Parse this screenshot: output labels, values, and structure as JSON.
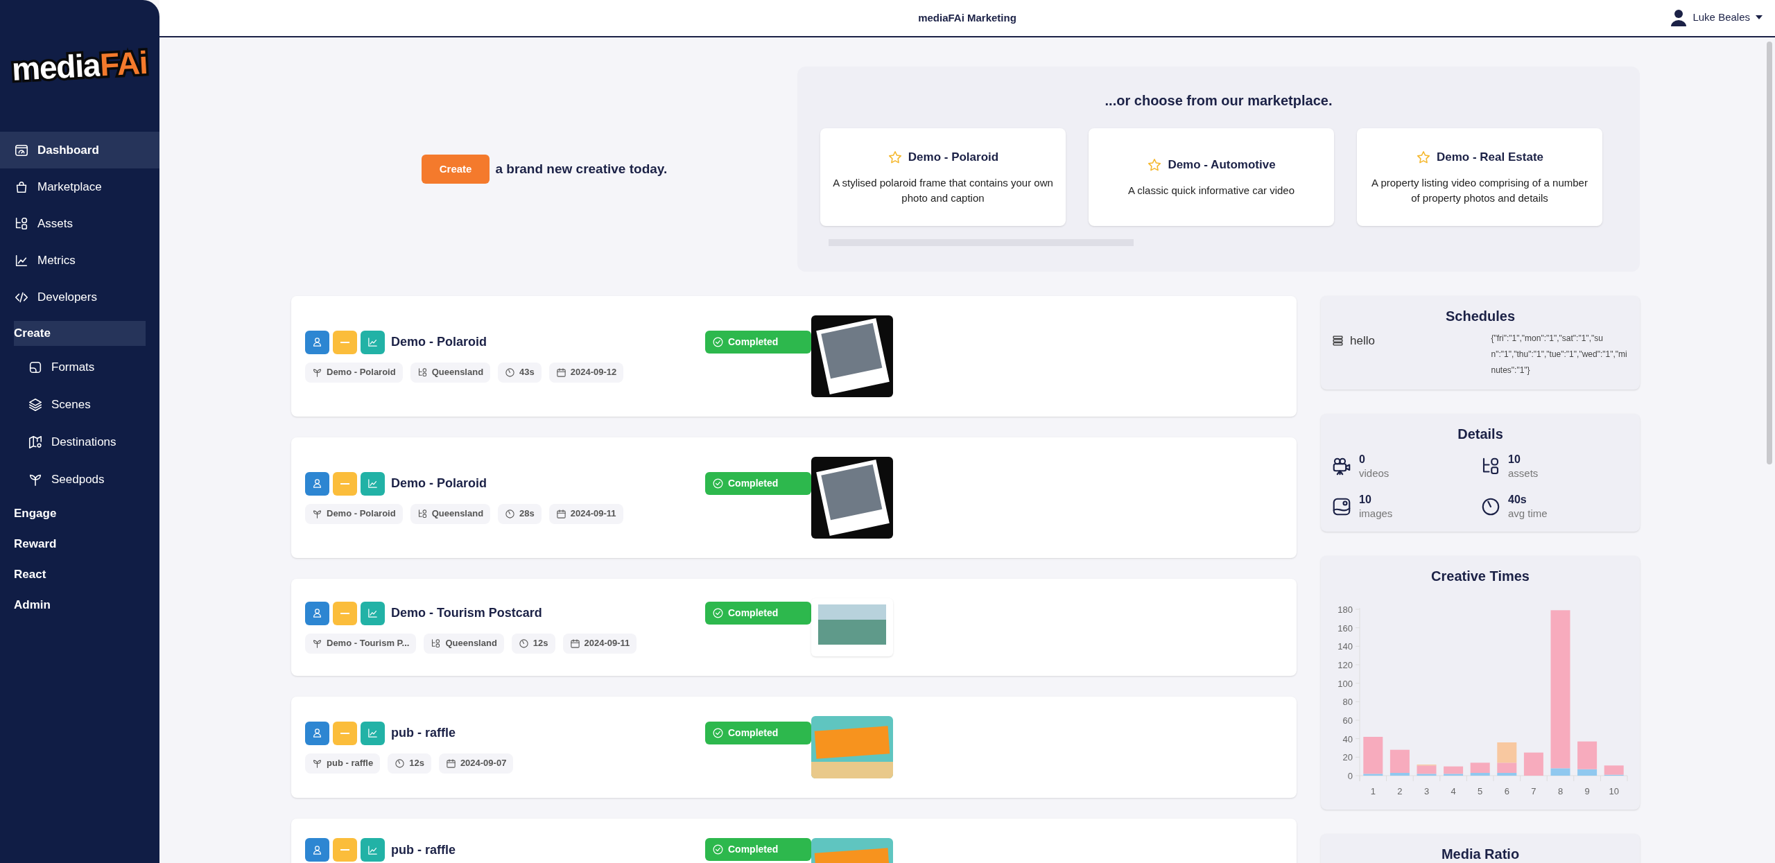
{
  "sidebar": {
    "logo": {
      "text": "media",
      "accent": "FAi"
    },
    "items": [
      {
        "kind": "link",
        "label": "Dashboard",
        "selected": true
      },
      {
        "kind": "link",
        "label": "Marketplace",
        "selected": false
      },
      {
        "kind": "link",
        "label": "Assets",
        "selected": false
      },
      {
        "kind": "link",
        "label": "Metrics",
        "selected": false
      },
      {
        "kind": "link",
        "label": "Developers",
        "selected": false
      },
      {
        "kind": "section",
        "label": "Create",
        "selected": true,
        "children": [
          {
            "label": "Formats",
            "selected": false
          },
          {
            "label": "Scenes",
            "selected": false
          },
          {
            "label": "Destinations",
            "selected": false
          },
          {
            "label": "Seedpods",
            "selected": false
          }
        ]
      },
      {
        "kind": "section",
        "label": "Engage",
        "selected": false
      },
      {
        "kind": "section",
        "label": "Reward",
        "selected": false
      },
      {
        "kind": "section",
        "label": "React",
        "selected": false
      },
      {
        "kind": "section",
        "label": "Admin",
        "selected": false
      }
    ]
  },
  "header": {
    "title": "mediaFAi Marketing",
    "user": "Luke Beales"
  },
  "hero": {
    "create_button": "Create",
    "tagline": "a brand new creative today."
  },
  "marketplace": {
    "title": "...or choose from our marketplace.",
    "cards": [
      {
        "title": "Demo - Polaroid",
        "description": "A stylised polaroid frame that contains your own photo and caption"
      },
      {
        "title": "Demo - Automotive",
        "description": "A classic quick informative car video"
      },
      {
        "title": "Demo - Real Estate",
        "description": "A property listing video comprising of a number of property photos and details"
      }
    ]
  },
  "creatives": [
    {
      "title": "Demo - Polaroid",
      "status": "Completed",
      "meta": [
        {
          "kind": "seedpod",
          "text": "Demo - Polaroid"
        },
        {
          "kind": "location",
          "text": "Queensland"
        },
        {
          "kind": "duration",
          "text": "43s"
        },
        {
          "kind": "date",
          "text": "2024-09-12"
        }
      ]
    },
    {
      "title": "Demo - Polaroid",
      "status": "Completed",
      "meta": [
        {
          "kind": "seedpod",
          "text": "Demo - Polaroid"
        },
        {
          "kind": "location",
          "text": "Queensland"
        },
        {
          "kind": "duration",
          "text": "28s"
        },
        {
          "kind": "date",
          "text": "2024-09-11"
        }
      ]
    },
    {
      "title": "Demo - Tourism Postcard",
      "status": "Completed",
      "meta": [
        {
          "kind": "seedpod",
          "text": "Demo - Tourism P..."
        },
        {
          "kind": "location",
          "text": "Queensland"
        },
        {
          "kind": "duration",
          "text": "12s"
        },
        {
          "kind": "date",
          "text": "2024-09-11"
        }
      ]
    },
    {
      "title": "pub - raffle",
      "status": "Completed",
      "meta": [
        {
          "kind": "seedpod",
          "text": "pub - raffle"
        },
        {
          "kind": "duration",
          "text": "12s"
        },
        {
          "kind": "date",
          "text": "2024-09-07"
        }
      ]
    },
    {
      "title": "pub - raffle",
      "status": "Completed"
    }
  ],
  "schedules": {
    "title": "Schedules",
    "items": [
      {
        "name": "hello",
        "value": "{\"fri\":\"1\",\"mon\":\"1\",\"sat\":\"1\",\"sun\":\"1\",\"thu\":\"1\",\"tue\":\"1\",\"wed\":\"1\",\"minutes\":\"1\"}"
      }
    ]
  },
  "details": {
    "title": "Details",
    "stats": [
      {
        "value": "0",
        "label": "videos"
      },
      {
        "value": "10",
        "label": "assets"
      },
      {
        "value": "10",
        "label": "images"
      },
      {
        "value": "40s",
        "label": "avg time"
      }
    ]
  },
  "creative_times": {
    "title": "Creative Times",
    "chart_data": {
      "type": "bar",
      "stacked": true,
      "categories": [
        "1",
        "2",
        "3",
        "4",
        "5",
        "6",
        "7",
        "8",
        "9",
        "10"
      ],
      "series": [
        {
          "color": "#90c8ef",
          "values": [
            2,
            3,
            2,
            2,
            3,
            3,
            0,
            8,
            7,
            1
          ]
        },
        {
          "color": "#f7abbd",
          "values": [
            40,
            25,
            9,
            8,
            11,
            11,
            25,
            171,
            30,
            10
          ]
        },
        {
          "color": "#f8c8a0",
          "values": [
            0,
            0,
            1,
            0,
            0,
            22,
            0,
            0,
            0,
            0
          ]
        }
      ],
      "ylim": [
        0,
        180
      ],
      "yticks": [
        0,
        20,
        40,
        60,
        80,
        100,
        120,
        140,
        160,
        180
      ]
    }
  },
  "media_ratio": {
    "title": "Media Ratio"
  }
}
